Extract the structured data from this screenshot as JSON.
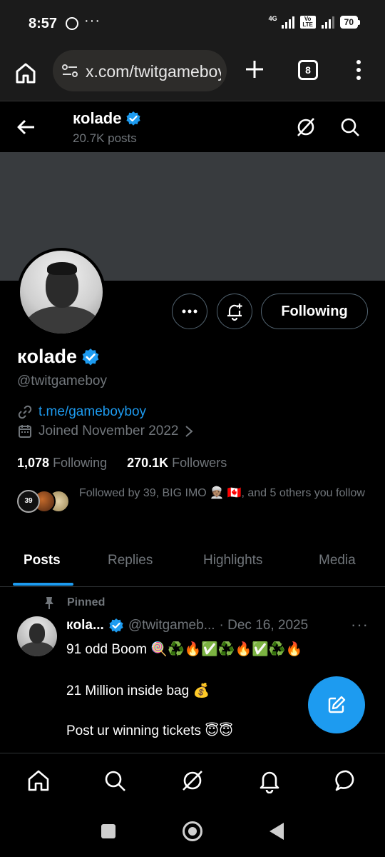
{
  "status_bar": {
    "time": "8:57",
    "dots": "···",
    "net_label": "4G",
    "volte": "Vo LTE",
    "battery": "70"
  },
  "browser": {
    "url": "x.com/twitgameboy",
    "tab_count": "8"
  },
  "header": {
    "name": "кolade",
    "posts": "20.7K posts"
  },
  "profile": {
    "name": "кolade",
    "handle": "@twitgameboy",
    "link": "t.me/gameboyboy",
    "joined": "Joined November 2022",
    "following_count": "1,078",
    "following_label": "Following",
    "followers_count": "270.1K",
    "followers_label": "Followers",
    "followed_by_badge": "39",
    "followed_by": "Followed by 39, BIG IMO 👳🏽 🇨🇦, and 5 others you follow",
    "following_button": "Following"
  },
  "tabs": [
    {
      "label": "Posts",
      "active": true
    },
    {
      "label": "Replies",
      "active": false
    },
    {
      "label": "Highlights",
      "active": false
    },
    {
      "label": "Media",
      "active": false
    }
  ],
  "post": {
    "pinned_label": "Pinned",
    "author": "кola...",
    "handle": "@twitgameb...",
    "date": "· Dec 16, 2025",
    "more": "···",
    "lines": [
      "91 odd Boom 🍭♻️🔥✅♻️🔥✅♻️🔥",
      "21 Million inside bag 💰",
      "Post ur winning tickets 😇😇"
    ]
  },
  "colors": {
    "accent": "#1d9bf0",
    "muted": "#71767b",
    "banner": "#383b3e",
    "chrome_bg": "#1b1b1b"
  },
  "icons": {
    "nav": [
      "home-icon",
      "search-icon",
      "grok-icon",
      "notifications-icon",
      "messages-icon"
    ]
  }
}
